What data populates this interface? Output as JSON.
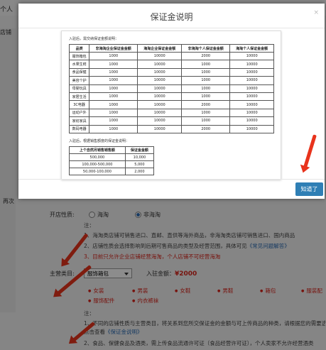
{
  "background": {
    "tab_label": "个人",
    "nav_label": "店铺",
    "section_label": "再次",
    "form": {
      "shop_nature_label": "开店性质:",
      "shop_nature_options": [
        "海淘",
        "非海淘"
      ],
      "note_label": "注：",
      "notes": [
        "1、海淘类店铺可销售进口、直邮、直供等海外商品，非海淘类店铺可销售进口、国内商品",
        "2、店铺性质会选择影响到后期可售商品的类型及经营范围，具体可见",
        "3、目前只允许企业店铺经营海淘，个人店铺不可经营海淘"
      ],
      "notes_link": "《常见问题解答》",
      "category_label": "主营类目:",
      "category_value": "服饰箱包",
      "deposit_label": "入驻金额：",
      "deposit_value": "¥2000",
      "categories": [
        "女装",
        "男装",
        "女鞋",
        "男鞋",
        "箱包",
        "服装配",
        "服饰配件",
        "内衣裤袜"
      ],
      "note2_label": "注：",
      "notes2": [
        "1、不同的店铺性质与主营类目，将关系到您所交保证金的金额与可上传商品的种类，请根据您的需要选择",
        "点击查看",
        "2、食品、保健食品及酒类，需上传食品流通许可证（食品经营许可证），个人卖家不允许经营酒类"
      ],
      "notes2_link": "《保证金说明》"
    }
  },
  "modal": {
    "title": "保证金说明",
    "close_icon": "×",
    "doc": {
      "caption1": "入驻后，需交纳保证金额说明：",
      "table1": {
        "headers": [
          "品类",
          "非海淘企业保证金金额",
          "海淘企业保证金金额",
          "非海淘个人保证金金额",
          "海淘个人保证金金额"
        ],
        "rows": [
          [
            "服饰箱包",
            "1000",
            "10000",
            "2000",
            "10000"
          ],
          [
            "水果生鲜",
            "1000",
            "10000",
            "1000",
            "10000"
          ],
          [
            "食品保健",
            "1000",
            "10000",
            "1000",
            "10000"
          ],
          [
            "美容个护",
            "1000",
            "10000",
            "1000",
            "10000"
          ],
          [
            "母婴玩具",
            "1000",
            "10000",
            "1000",
            "10000"
          ],
          [
            "家居生活",
            "1000",
            "10000",
            "1000",
            "10000"
          ],
          [
            "3C电器",
            "1000",
            "10000",
            "2000",
            "10000"
          ],
          [
            "运动户外",
            "1000",
            "10000",
            "1000",
            "10000"
          ],
          [
            "家纺家具",
            "1000",
            "10000",
            "1000",
            "10000"
          ],
          [
            "数码电器",
            "1000",
            "10000",
            "2000",
            "10000"
          ]
        ]
      },
      "caption2": "入驻后，根据销售额度的保证金说明：",
      "table2": {
        "headers": [
          "上个自然月销售销售额",
          "保证金金额"
        ],
        "rows": [
          [
            "500,000",
            "10,000"
          ],
          [
            "100,000-500,000",
            "5,000"
          ],
          [
            "50,000-100,000",
            "2,000"
          ]
        ]
      }
    },
    "confirm_button": "知道了"
  },
  "colors": {
    "accent": "#2f7fb5",
    "arrow": "#e8331c",
    "highlight_red": "#d9251c"
  }
}
